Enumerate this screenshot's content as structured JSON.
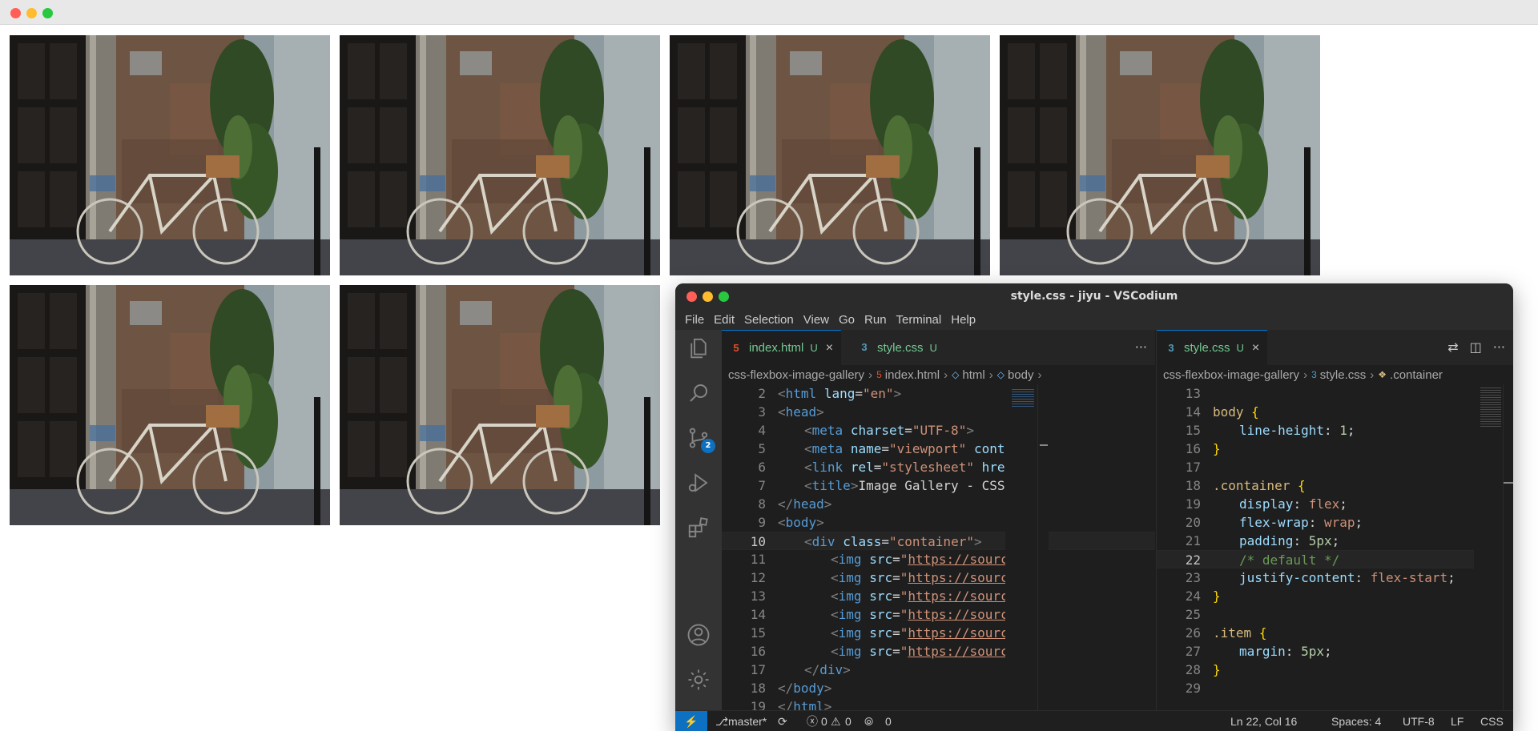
{
  "gallery": {
    "image_count": 6
  },
  "vscodium": {
    "title": "style.css - jiyu - VSCodium",
    "menu": [
      "File",
      "Edit",
      "Selection",
      "View",
      "Go",
      "Run",
      "Terminal",
      "Help"
    ],
    "scm_badge": "2",
    "left_group": {
      "tabs": [
        {
          "label": "index.html",
          "status": "U",
          "icon": "html-file-icon"
        },
        {
          "label": "style.css",
          "status": "U",
          "icon": "css-file-icon"
        }
      ],
      "breadcrumb": [
        "css-flexbox-image-gallery",
        "index.html",
        "html",
        "body"
      ],
      "lines": [
        {
          "n": "2",
          "html": "<span class='t-punc'>&lt;</span><span class='t-tag'>html</span> <span class='t-attr'>lang</span><span class='t-text'>=</span><span class='t-str'>\"en\"</span><span class='t-punc'>&gt;</span>",
          "indent": 0
        },
        {
          "n": "3",
          "html": "<span class='t-punc'>&lt;</span><span class='t-tag'>head</span><span class='t-punc'>&gt;</span>",
          "indent": 0
        },
        {
          "n": "4",
          "html": "<span class='t-punc'>&lt;</span><span class='t-tag'>meta</span> <span class='t-attr'>charset</span><span class='t-text'>=</span><span class='t-str'>\"UTF-8\"</span><span class='t-punc'>&gt;</span>",
          "indent": 1
        },
        {
          "n": "5",
          "html": "<span class='t-punc'>&lt;</span><span class='t-tag'>meta</span> <span class='t-attr'>name</span><span class='t-text'>=</span><span class='t-str'>\"viewport\"</span> <span class='t-attr'>content</span><span class='t-text'>=</span><span class='t-str'>\"</span>",
          "indent": 1
        },
        {
          "n": "6",
          "html": "<span class='t-punc'>&lt;</span><span class='t-tag'>link</span> <span class='t-attr'>rel</span><span class='t-text'>=</span><span class='t-str'>\"stylesheet\"</span> <span class='t-attr'>href</span><span class='t-text'>=</span><span class='t-str'>\"st</span>",
          "indent": 1
        },
        {
          "n": "7",
          "html": "<span class='t-punc'>&lt;</span><span class='t-tag'>title</span><span class='t-punc'>&gt;</span><span class='t-text'>Image Gallery - CSS Flex</span>",
          "indent": 1
        },
        {
          "n": "8",
          "html": "<span class='t-punc'>&lt;/</span><span class='t-tag'>head</span><span class='t-punc'>&gt;</span>",
          "indent": 0
        },
        {
          "n": "9",
          "html": "<span class='t-punc'>&lt;</span><span class='t-tag'>body</span><span class='t-punc'>&gt;</span>",
          "indent": 0
        },
        {
          "n": "10",
          "html": "<span class='t-punc'>&lt;</span><span class='t-tag'>div</span> <span class='t-attr'>class</span><span class='t-text'>=</span><span class='t-str'>\"container\"</span><span class='t-punc'>&gt;</span>",
          "indent": 1
        },
        {
          "n": "11",
          "html": "<span class='t-punc'>&lt;</span><span class='t-tag'>img</span> <span class='t-attr'>src</span><span class='t-text'>=</span><span class='t-str'>\"</span><span class='t-url'>https://source.un</span>",
          "indent": 2
        },
        {
          "n": "12",
          "html": "<span class='t-punc'>&lt;</span><span class='t-tag'>img</span> <span class='t-attr'>src</span><span class='t-text'>=</span><span class='t-str'>\"</span><span class='t-url'>https://source.un</span>",
          "indent": 2
        },
        {
          "n": "13",
          "html": "<span class='t-punc'>&lt;</span><span class='t-tag'>img</span> <span class='t-attr'>src</span><span class='t-text'>=</span><span class='t-str'>\"</span><span class='t-url'>https://source.un</span>",
          "indent": 2
        },
        {
          "n": "14",
          "html": "<span class='t-punc'>&lt;</span><span class='t-tag'>img</span> <span class='t-attr'>src</span><span class='t-text'>=</span><span class='t-str'>\"</span><span class='t-url'>https://source.un</span>",
          "indent": 2
        },
        {
          "n": "15",
          "html": "<span class='t-punc'>&lt;</span><span class='t-tag'>img</span> <span class='t-attr'>src</span><span class='t-text'>=</span><span class='t-str'>\"</span><span class='t-url'>https://source.un</span>",
          "indent": 2
        },
        {
          "n": "16",
          "html": "<span class='t-punc'>&lt;</span><span class='t-tag'>img</span> <span class='t-attr'>src</span><span class='t-text'>=</span><span class='t-str'>\"</span><span class='t-url'>https://source.un</span>",
          "indent": 2
        },
        {
          "n": "17",
          "html": "<span class='t-punc'>&lt;/</span><span class='t-tag'>div</span><span class='t-punc'>&gt;</span>",
          "indent": 1
        },
        {
          "n": "18",
          "html": "<span class='t-punc'>&lt;/</span><span class='t-tag'>body</span><span class='t-punc'>&gt;</span>",
          "indent": 0
        },
        {
          "n": "19",
          "html": "<span class='t-punc'>&lt;/</span><span class='t-tag'>html</span><span class='t-punc'>&gt;</span>",
          "indent": 0
        }
      ],
      "current_line": "10"
    },
    "right_group": {
      "tabs": [
        {
          "label": "style.css",
          "status": "U",
          "icon": "css-file-icon"
        }
      ],
      "breadcrumb": [
        "css-flexbox-image-gallery",
        "style.css",
        ".container"
      ],
      "lines": [
        {
          "n": "13",
          "html": "",
          "indent": 0
        },
        {
          "n": "14",
          "html": "<span class='t-sel'>body</span> <span class='t-brace'>{</span>",
          "indent": 0
        },
        {
          "n": "15",
          "html": "<span class='t-prop'>line-height</span><span class='t-text'>: </span><span class='t-num'>1</span><span class='t-text'>;</span>",
          "indent": 1
        },
        {
          "n": "16",
          "html": "<span class='t-brace'>}</span>",
          "indent": 0
        },
        {
          "n": "17",
          "html": "",
          "indent": 0
        },
        {
          "n": "18",
          "html": "<span class='t-sel'>.container</span> <span class='t-brace'>{</span>",
          "indent": 0
        },
        {
          "n": "19",
          "html": "<span class='t-prop'>display</span><span class='t-text'>: </span><span class='t-val'>flex</span><span class='t-text'>;</span>",
          "indent": 1
        },
        {
          "n": "20",
          "html": "<span class='t-prop'>flex-wrap</span><span class='t-text'>: </span><span class='t-val'>wrap</span><span class='t-text'>;</span>",
          "indent": 1
        },
        {
          "n": "21",
          "html": "<span class='t-prop'>padding</span><span class='t-text'>: </span><span class='t-num'>5px</span><span class='t-text'>;</span>",
          "indent": 1
        },
        {
          "n": "22",
          "html": "<span class='t-com'>/* default */</span>",
          "indent": 1
        },
        {
          "n": "23",
          "html": "<span class='t-prop'>justify-content</span><span class='t-text'>: </span><span class='t-val'>flex-start</span><span class='t-text'>;</span>",
          "indent": 1
        },
        {
          "n": "24",
          "html": "<span class='t-brace'>}</span>",
          "indent": 0
        },
        {
          "n": "25",
          "html": "",
          "indent": 0
        },
        {
          "n": "26",
          "html": "<span class='t-sel'>.item</span> <span class='t-brace'>{</span>",
          "indent": 0
        },
        {
          "n": "27",
          "html": "<span class='t-prop'>margin</span><span class='t-text'>: </span><span class='t-num'>5px</span><span class='t-text'>;</span>",
          "indent": 1
        },
        {
          "n": "28",
          "html": "<span class='t-brace'>}</span>",
          "indent": 0
        },
        {
          "n": "29",
          "html": "",
          "indent": 0
        }
      ],
      "current_line": "22"
    },
    "status": {
      "branch": "master*",
      "errors": "0",
      "warnings": "0",
      "ports": "0",
      "cursor": "Ln 22, Col 16",
      "spaces": "Spaces: 4",
      "encoding": "UTF-8",
      "eol": "LF",
      "language": "CSS"
    },
    "colors": {
      "accent": "#0078d4",
      "status_remote": "#0e70c0",
      "html_icon": "#e44d26",
      "css_icon": "#519aba",
      "untracked": "#73c991"
    }
  }
}
